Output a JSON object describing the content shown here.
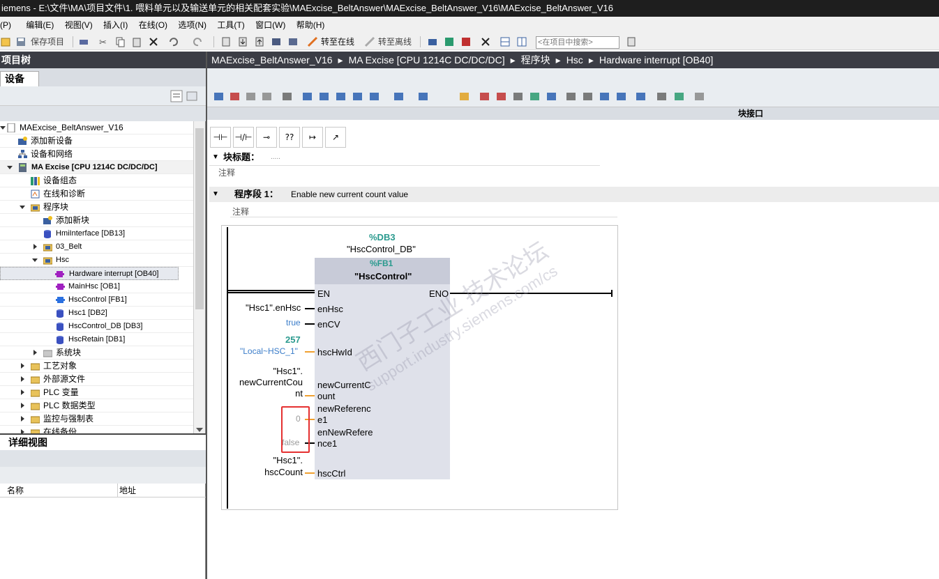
{
  "window": {
    "title": "iemens  -  E:\\文件\\MA\\项目文件\\1. 喂料单元以及输送单元的相关配套实验\\MAExcise_BeltAnswer\\MAExcise_BeltAnswer_V16\\MAExcise_BeltAnswer_V16"
  },
  "menu": [
    "(P)",
    "编辑(E)",
    "视图(V)",
    "插入(I)",
    "在线(O)",
    "选项(N)",
    "工具(T)",
    "窗口(W)",
    "帮助(H)"
  ],
  "toolbar": {
    "save_project": "保存项目",
    "go_online": "转至在线",
    "go_offline": "转至离线",
    "search_placeholder": "<在项目中搜索>"
  },
  "left_panel": {
    "title": "项目树",
    "tab": "设备",
    "tree": [
      {
        "label": "MAExcise_BeltAnswer_V16",
        "icon": "project-icon"
      },
      {
        "label": "添加新设备",
        "icon": "add-device-icon"
      },
      {
        "label": "设备和网络",
        "icon": "network-icon"
      },
      {
        "label": "MA Excise [CPU 1214C DC/DC/DC]",
        "icon": "cpu-icon"
      },
      {
        "label": "设备组态",
        "icon": "device-config-icon"
      },
      {
        "label": "在线和诊断",
        "icon": "online-diag-icon"
      },
      {
        "label": "程序块",
        "icon": "folder-icon"
      },
      {
        "label": "添加新块",
        "icon": "add-block-icon"
      },
      {
        "label": "HmiInterface [DB13]",
        "icon": "db-icon"
      },
      {
        "label": "03_Belt",
        "icon": "folder-icon"
      },
      {
        "label": "Hsc",
        "icon": "folder-icon"
      },
      {
        "label": "Hardware interrupt [OB40]",
        "icon": "ob-icon"
      },
      {
        "label": "MainHsc [OB1]",
        "icon": "ob-icon"
      },
      {
        "label": "HscControl [FB1]",
        "icon": "fb-icon"
      },
      {
        "label": "Hsc1 [DB2]",
        "icon": "db-icon"
      },
      {
        "label": "HscControl_DB [DB3]",
        "icon": "db-icon"
      },
      {
        "label": "HscRetain [DB1]",
        "icon": "db-icon"
      },
      {
        "label": "系统块",
        "icon": "system-block-icon"
      },
      {
        "label": "工艺对象",
        "icon": "tech-object-icon"
      },
      {
        "label": "外部源文件",
        "icon": "source-file-icon"
      },
      {
        "label": "PLC 变量",
        "icon": "plc-tag-icon"
      },
      {
        "label": "PLC 数据类型",
        "icon": "plc-type-icon"
      },
      {
        "label": "监控与强制表",
        "icon": "watch-table-icon"
      },
      {
        "label": "在线备份",
        "icon": "online-backup-icon"
      }
    ],
    "detail_view": {
      "title": "详细视图",
      "col_name": "名称",
      "col_address": "地址"
    }
  },
  "breadcrumb": [
    "MAExcise_BeltAnswer_V16",
    "MA Excise [CPU 1214C DC/DC/DC]",
    "程序块",
    "Hsc",
    "Hardware interrupt [OB40]"
  ],
  "editor": {
    "interface_label": "块接口",
    "block_title_label": "块标题：",
    "block_title_value": ".....",
    "comment": "注释",
    "network_label": "程序段 1：",
    "network_title": "Enable new current count value",
    "network_comment": "注释",
    "ladder_buttons": [
      "⊣⊢",
      "⊣/⊢",
      "⊸",
      "??",
      "↦",
      "↗"
    ]
  },
  "fbd": {
    "instance_addr": "%DB3",
    "instance_name": "\"HscControl_DB\"",
    "fb_addr": "%FB1",
    "fb_name": "\"HscControl\"",
    "en": "EN",
    "eno": "ENO",
    "inputs": [
      {
        "pin": "enHsc",
        "arg": "\"Hsc1\".enHsc"
      },
      {
        "pin": "enCV",
        "arg": "true"
      },
      {
        "pin": "hscHwId",
        "arg_value": "257",
        "arg": "\"Local~HSC_1\""
      },
      {
        "pin": "newCurrentC\nount",
        "arg": "\"Hsc1\".\nnewCurrentCou\nnt"
      },
      {
        "pin": "newReferenc\ne1",
        "arg": "0"
      },
      {
        "pin": "enNewRefere\nnce1",
        "arg": "false"
      },
      {
        "pin": "hscCtrl",
        "arg": "\"Hsc1\".\nhscCount"
      }
    ]
  },
  "watermark": {
    "cn": "西门子工业 技术论坛",
    "url": "support.industry.siemens.com/cs"
  },
  "colors": {
    "header_dark": "#3b3d45",
    "fb_block": "#dfe1ea",
    "teal": "#2a9a8e",
    "highlight_red": "#e53030",
    "wire_orange": "#f0a030"
  }
}
